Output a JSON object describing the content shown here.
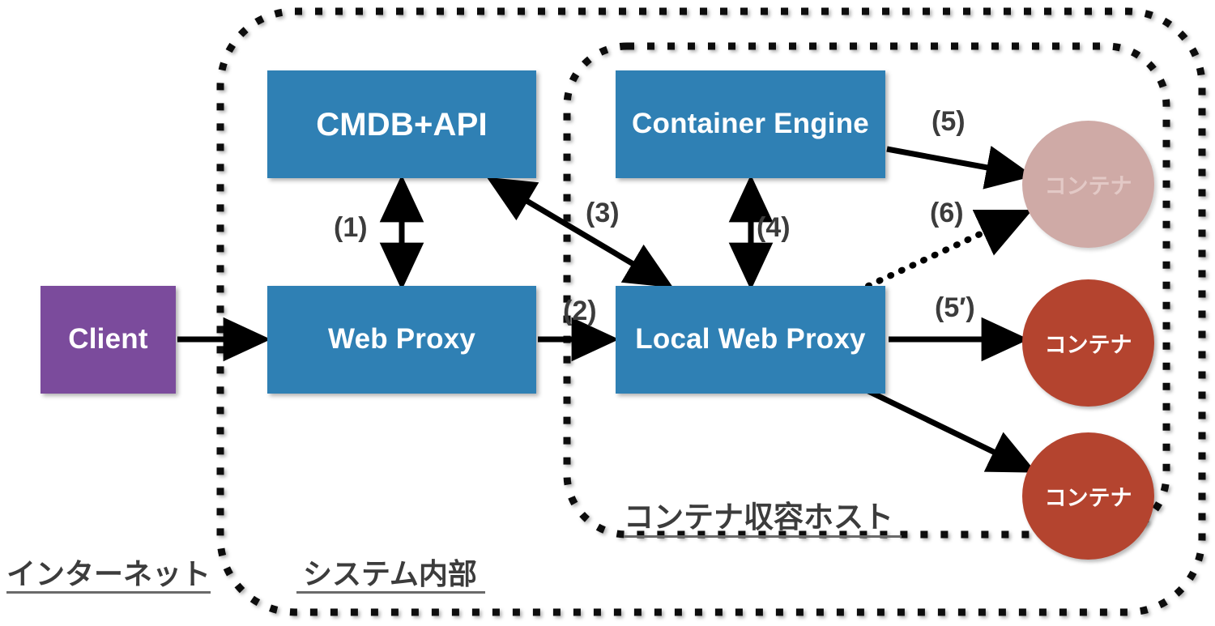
{
  "diagram": {
    "title": "Container-hosting web proxy architecture",
    "colors": {
      "box_blue": "#2f80b4",
      "client_purple": "#7b4b9c",
      "container_red": "#b4442f",
      "container_ghost_pink": "#cfaaa6",
      "text_dark": "#3c3c3c",
      "arrow_black": "#000000",
      "background": "#ffffff"
    },
    "nodes": {
      "client": "Client",
      "cmdb": "CMDB+API",
      "web_proxy": "Web Proxy",
      "container_engine": "Container Engine",
      "local_web_proxy": "Local Web Proxy",
      "container_ghost": "コンテナ",
      "container_top": "コンテナ",
      "container_bottom": "コンテナ"
    },
    "flow_labels": {
      "step1": "(1)",
      "step2": "(2)",
      "step3": "(3)",
      "step4": "(4)",
      "step5": "(5)",
      "step6": "(6)",
      "step5_prime": "(5′)"
    },
    "zones": {
      "internet": "インターネット",
      "system_internal": "システム内部",
      "container_host": "コンテナ収容ホスト"
    },
    "connections": [
      {
        "id": "client-to-web-proxy",
        "from": "client",
        "to": "web_proxy",
        "style": "solid",
        "heads": "single",
        "label": ""
      },
      {
        "id": "cmdb-web-proxy",
        "from": "cmdb",
        "to": "web_proxy",
        "style": "solid",
        "heads": "double",
        "label": "(1)"
      },
      {
        "id": "web-proxy-to-local-proxy",
        "from": "web_proxy",
        "to": "local_web_proxy",
        "style": "solid",
        "heads": "single",
        "label": "(2)"
      },
      {
        "id": "cmdb-local-proxy",
        "from": "cmdb",
        "to": "local_web_proxy",
        "style": "solid",
        "heads": "double",
        "label": "(3)"
      },
      {
        "id": "container-engine-local-proxy",
        "from": "container_engine",
        "to": "local_web_proxy",
        "style": "solid",
        "heads": "double",
        "label": "(4)"
      },
      {
        "id": "container-engine-to-ghost",
        "from": "container_engine",
        "to": "container_ghost",
        "style": "solid",
        "heads": "single",
        "label": "(5)"
      },
      {
        "id": "local-proxy-to-ghost",
        "from": "local_web_proxy",
        "to": "container_ghost",
        "style": "dotted",
        "heads": "single",
        "label": "(6)"
      },
      {
        "id": "local-proxy-to-container-top",
        "from": "local_web_proxy",
        "to": "container_top",
        "style": "solid",
        "heads": "single",
        "label": "(5′)"
      },
      {
        "id": "local-proxy-to-container-bottom",
        "from": "local_web_proxy",
        "to": "container_bottom",
        "style": "solid",
        "heads": "single",
        "label": ""
      }
    ]
  }
}
